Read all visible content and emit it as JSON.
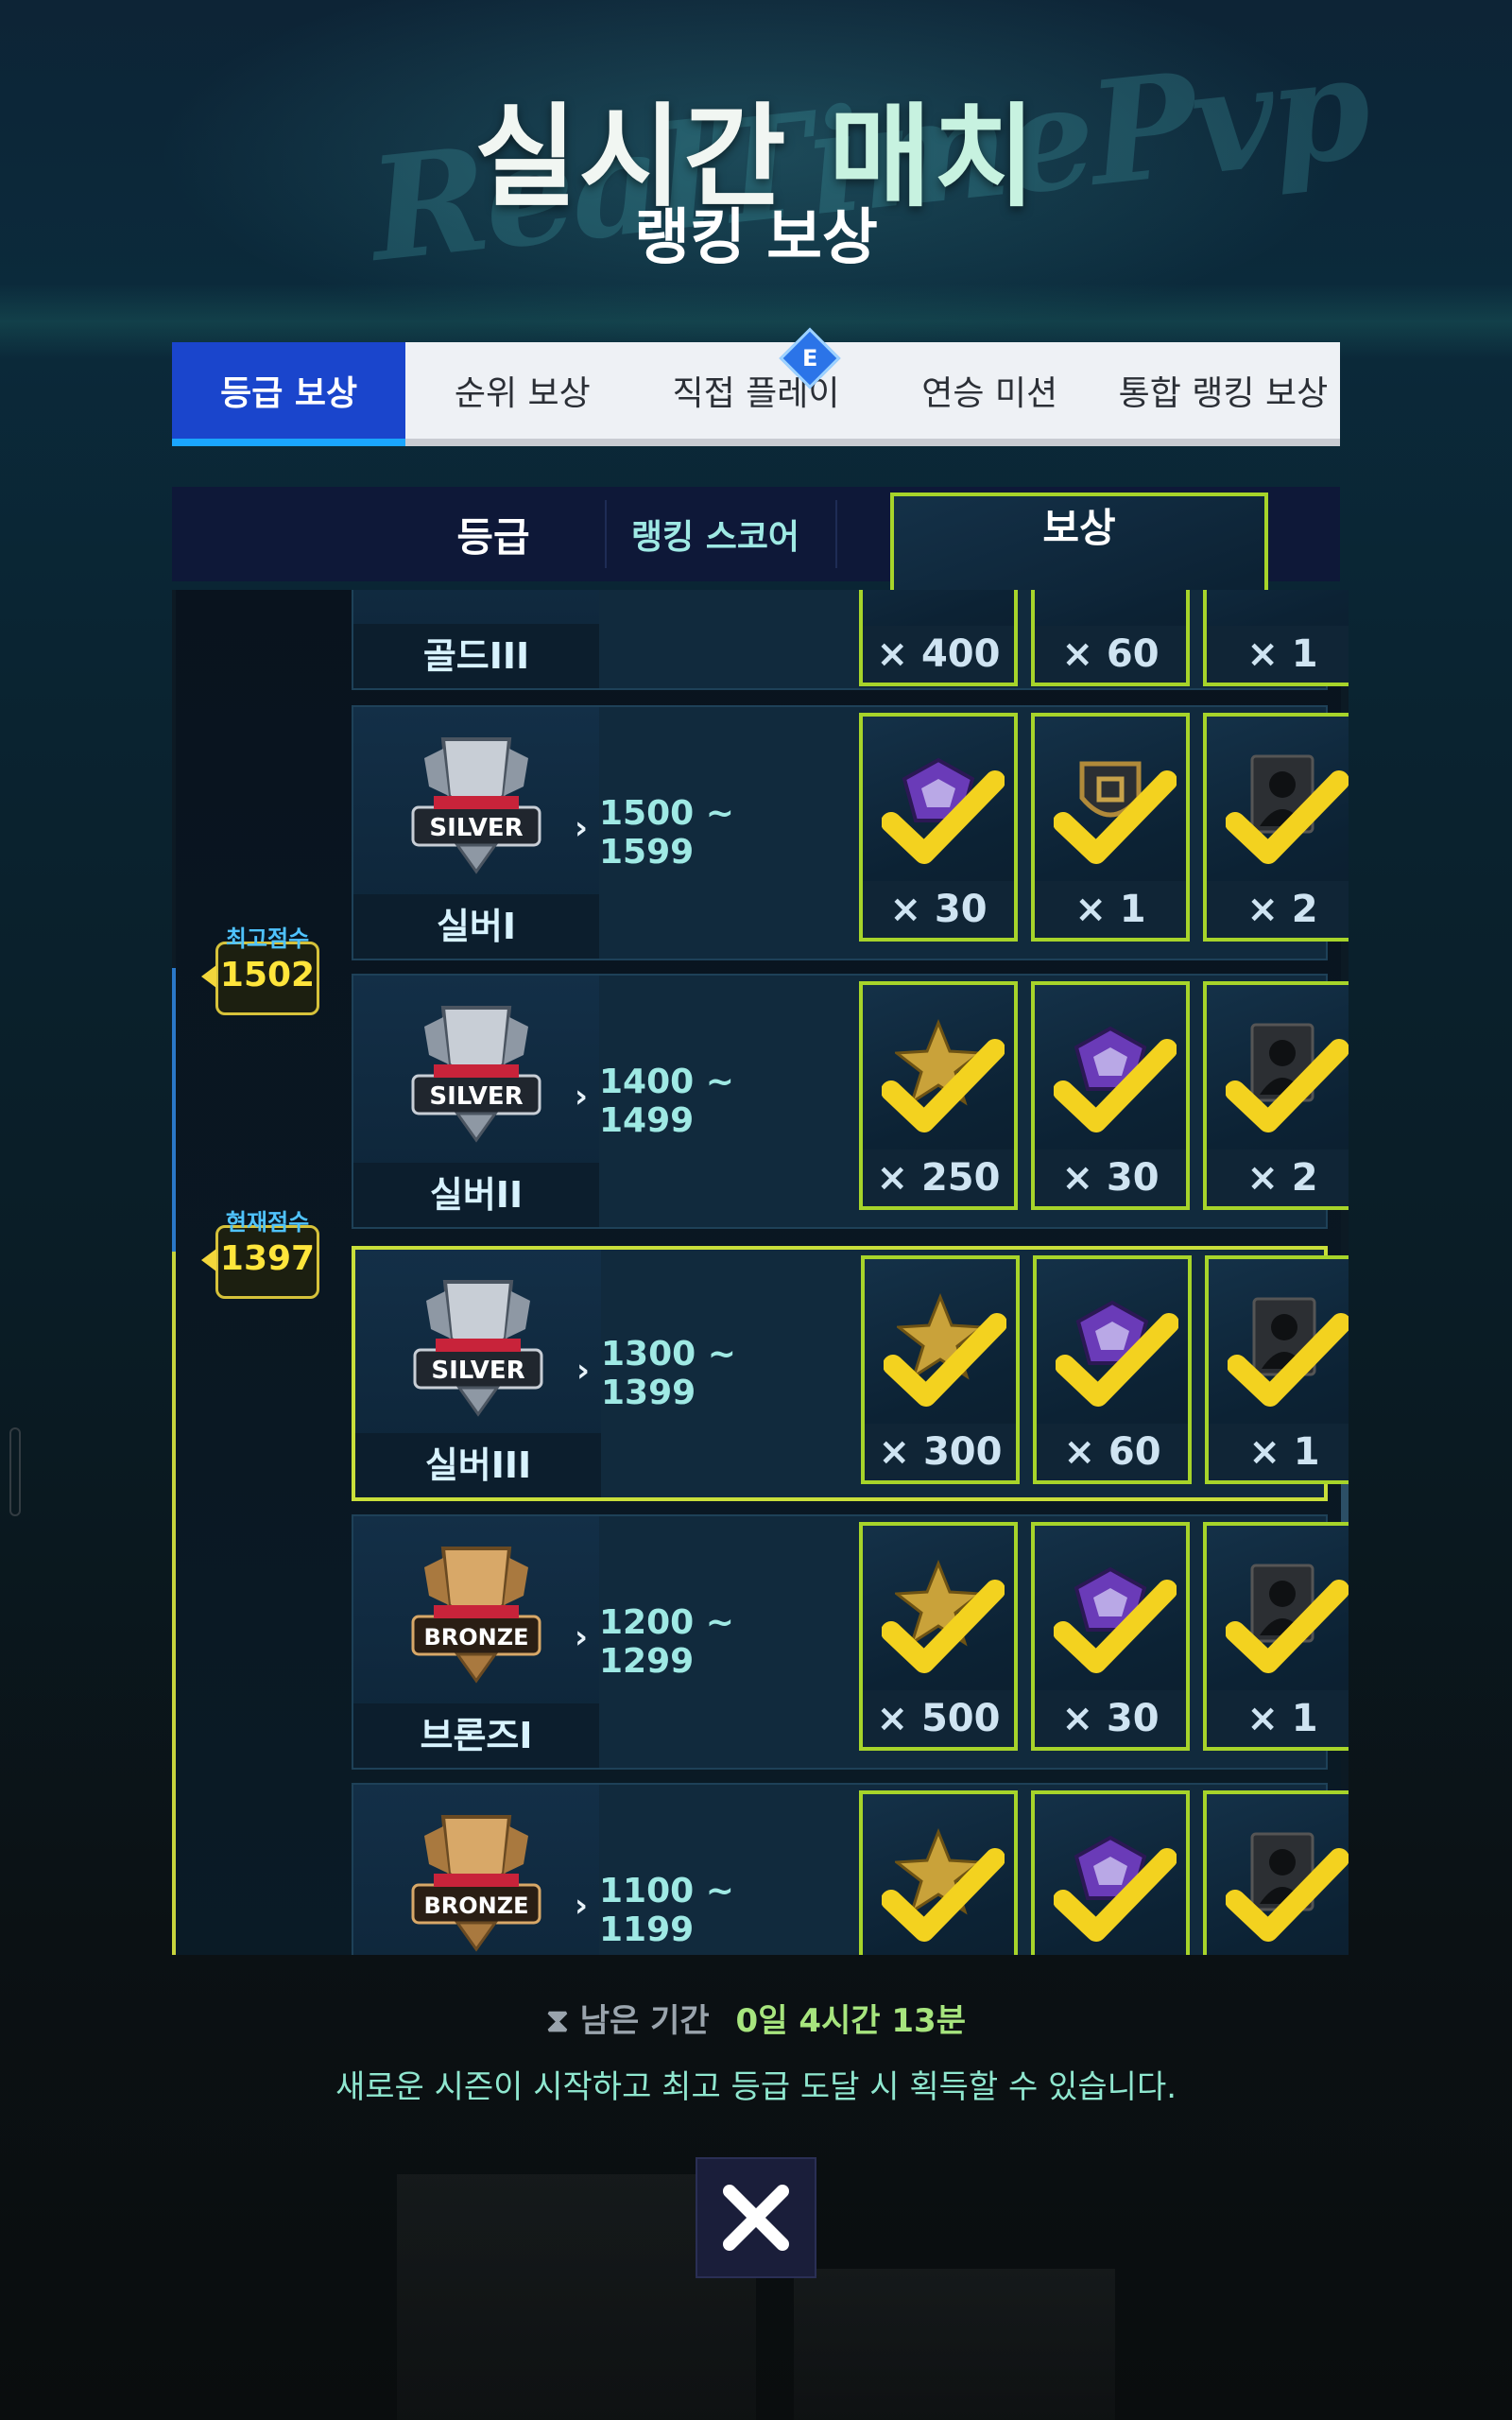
{
  "header": {
    "title_part1": "실시간 ",
    "title_part2": "매치",
    "subtitle": "랭킹 보상",
    "watermark": "RealTimePvp"
  },
  "tabs": [
    {
      "label": "등급 보상",
      "active": true
    },
    {
      "label": "순위 보상",
      "active": false
    },
    {
      "label": "직접 플레이",
      "active": false,
      "badge": "E"
    },
    {
      "label": "연승 미션",
      "active": false
    },
    {
      "label": "통합 랭킹 보상",
      "active": false
    }
  ],
  "columns": {
    "grade": "등급",
    "score": "랭킹 스코어",
    "reward": "보상"
  },
  "markers": {
    "best": {
      "label": "최고점수",
      "value": "1502"
    },
    "current": {
      "label": "현재점수",
      "value": "1397"
    }
  },
  "rows": [
    {
      "tier": "골드III",
      "emblem_text": "",
      "score": "",
      "rewards": [
        "× 400",
        "× 60",
        "× 1"
      ],
      "current": false
    },
    {
      "tier": "실버I",
      "emblem_text": "SILVER",
      "score": "1500 ~ 1599",
      "rewards": [
        "× 30",
        "× 1",
        "× 2"
      ],
      "reward_icons": [
        "purple-gem-icon",
        "shield-badge-icon",
        "player-card-icon"
      ],
      "current": false
    },
    {
      "tier": "실버II",
      "emblem_text": "SILVER",
      "score": "1400 ~ 1499",
      "rewards": [
        "× 250",
        "× 30",
        "× 2"
      ],
      "reward_icons": [
        "gold-star-icon",
        "purple-gem-icon",
        "player-card-icon"
      ],
      "current": false
    },
    {
      "tier": "실버III",
      "emblem_text": "SILVER",
      "score": "1300 ~ 1399",
      "rewards": [
        "× 300",
        "× 60",
        "× 1"
      ],
      "reward_icons": [
        "gold-star-icon",
        "purple-gem-icon",
        "player-card-icon"
      ],
      "current": true
    },
    {
      "tier": "브론즈I",
      "emblem_text": "BRONZE",
      "score": "1200 ~ 1299",
      "rewards": [
        "× 500",
        "× 30",
        "× 1"
      ],
      "reward_icons": [
        "gold-star-icon",
        "purple-gem-icon",
        "player-card-icon"
      ],
      "current": false
    },
    {
      "tier": "",
      "emblem_text": "BRONZE",
      "score": "1100 ~ 1199",
      "rewards": [
        "",
        "",
        ""
      ],
      "reward_icons": [
        "gold-star-icon",
        "purple-gem-icon",
        "player-card-icon"
      ],
      "current": false
    }
  ],
  "footer": {
    "remaining_label": "남은 기간",
    "remaining_time": "0일 4시간 13분",
    "notice": "새로운 시즌이 시작하고 최고 등급 도달 시 획득할 수 있습니다."
  },
  "colors": {
    "tab_active": "#1a45cc",
    "reward_border": "#a7d42a",
    "current_border": "#c9df3a",
    "score_text": "#9fe9e4",
    "marker_value": "#ffe53b"
  }
}
